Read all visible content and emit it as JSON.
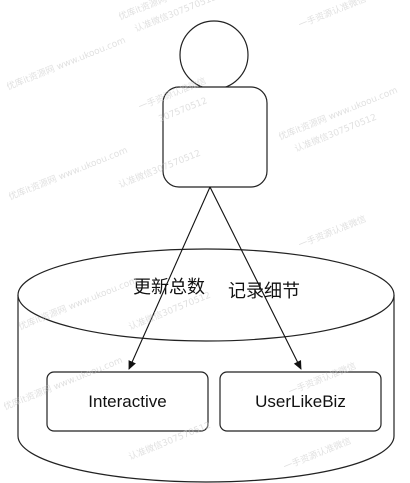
{
  "diagram": {
    "edges": [
      {
        "label": "更新总数"
      },
      {
        "label": "记录细节"
      }
    ],
    "nodes": [
      {
        "label": "Interactive"
      },
      {
        "label": "UserLikeBiz"
      }
    ]
  },
  "watermark": {
    "lines": [
      "优库it资源网 www.ukoou.com",
      "认准微信307570512",
      "一手资源认准微信",
      "307570512"
    ]
  }
}
